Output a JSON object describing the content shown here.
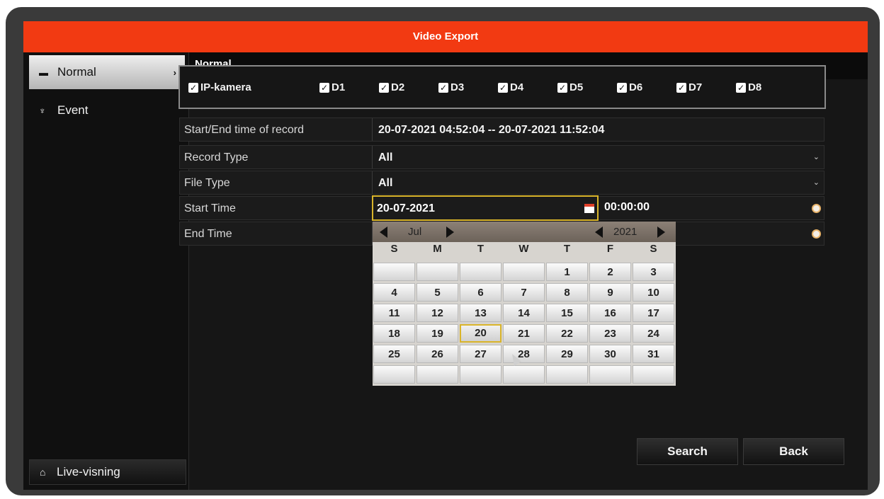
{
  "window": {
    "title": "Video Export"
  },
  "sidebar": {
    "items": [
      {
        "label": "Normal",
        "icon": "folder-icon",
        "active": true
      },
      {
        "label": "Event",
        "icon": "event-icon",
        "active": false
      }
    ],
    "live_button": "Live-visning"
  },
  "tabs": [
    {
      "label": "Normal",
      "active": true
    }
  ],
  "cameras": {
    "group": {
      "label": "IP-kamera",
      "checked": true
    },
    "channels": [
      {
        "label": "D1",
        "checked": true
      },
      {
        "label": "D2",
        "checked": true
      },
      {
        "label": "D3",
        "checked": true
      },
      {
        "label": "D4",
        "checked": true
      },
      {
        "label": "D5",
        "checked": true
      },
      {
        "label": "D6",
        "checked": true
      },
      {
        "label": "D7",
        "checked": true
      },
      {
        "label": "D8",
        "checked": true
      }
    ]
  },
  "form": {
    "record_range": {
      "label": "Start/End time of record",
      "value": "20-07-2021 04:52:04 -- 20-07-2021 11:52:04"
    },
    "record_type": {
      "label": "Record Type",
      "value": "All"
    },
    "file_type": {
      "label": "File Type",
      "value": "All"
    },
    "start_time": {
      "label": "Start Time",
      "date": "20-07-2021",
      "time": "00:00:00"
    },
    "end_time": {
      "label": "End Time"
    }
  },
  "calendar": {
    "month": "Jul",
    "year": "2021",
    "weekdays": [
      "S",
      "M",
      "T",
      "W",
      "T",
      "F",
      "S"
    ],
    "weeks": [
      [
        "",
        "",
        "",
        "",
        "1",
        "2",
        "3"
      ],
      [
        "4",
        "5",
        "6",
        "7",
        "8",
        "9",
        "10"
      ],
      [
        "11",
        "12",
        "13",
        "14",
        "15",
        "16",
        "17"
      ],
      [
        "18",
        "19",
        "20",
        "21",
        "22",
        "23",
        "24"
      ],
      [
        "25",
        "26",
        "27",
        "28",
        "29",
        "30",
        "31"
      ],
      [
        "",
        "",
        "",
        "",
        "",
        "",
        ""
      ]
    ],
    "selected": "20"
  },
  "buttons": {
    "search": "Search",
    "back": "Back"
  },
  "colors": {
    "title_bar": "#f23a12",
    "highlight": "#d9b42a"
  }
}
